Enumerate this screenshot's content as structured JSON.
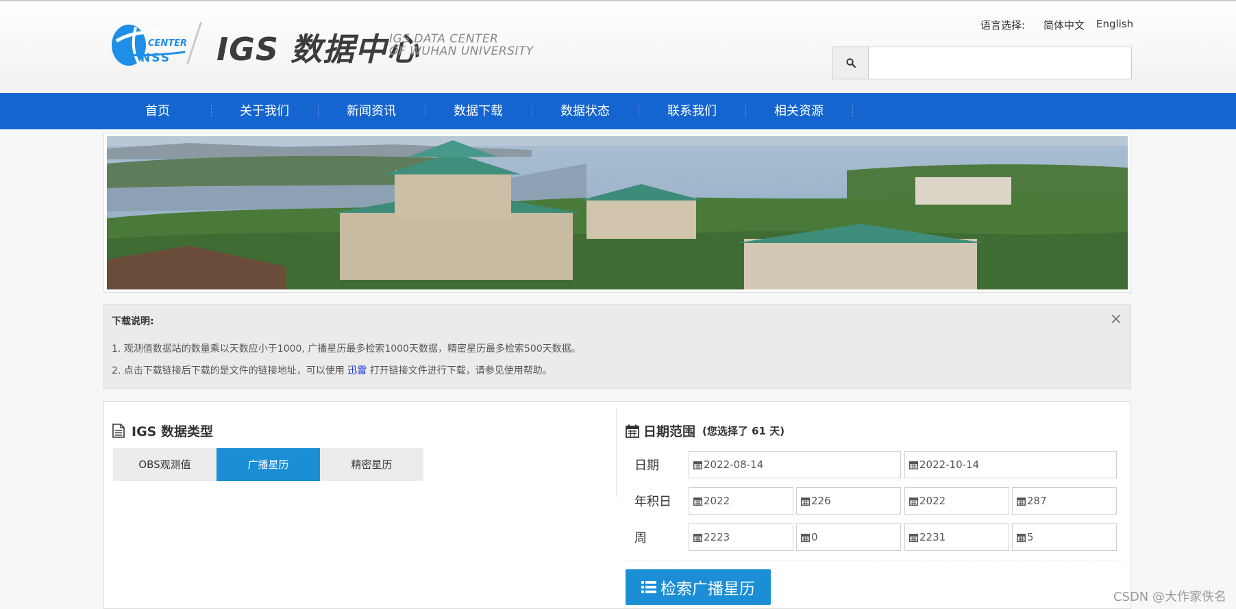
{
  "logo": {
    "mark_center": "CENTER",
    "mark_nss": "NSS",
    "title": "IGS 数据中心",
    "en_line1": "IGS DATA CENTER",
    "en_line2": "OF WUHAN UNIVERSITY"
  },
  "language": {
    "label": "语言选择:",
    "options": [
      "简体中文",
      "English"
    ]
  },
  "search": {
    "icon": "search-icon",
    "value": ""
  },
  "nav": {
    "items": [
      "首页",
      "关于我们",
      "新闻资讯",
      "数据下载",
      "数据状态",
      "联系我们",
      "相关资源"
    ]
  },
  "notice": {
    "title": "下载说明:",
    "line1": "1. 观测值数据站的数量乘以天数应小于1000, 广播星历最多检索1000天数据，精密星历最多检索500天数据。",
    "line2_before": "2. 点击下载链接后下载的是文件的链接地址，可以使用 ",
    "line2_link": "迅雷",
    "line2_after": " 打开链接文件进行下载，请参见使用帮助。",
    "close": "×"
  },
  "data_type": {
    "title": "IGS 数据类型",
    "tabs": [
      "OBS观测值",
      "广播星历",
      "精密星历"
    ],
    "active_tab": "广播星历"
  },
  "date_range": {
    "title": "日期范围",
    "note": "(您选择了 61 天)",
    "rows": [
      {
        "label": "日期",
        "fields": [
          "2022-08-14",
          "2022-10-14"
        ]
      },
      {
        "label": "年积日",
        "fields": [
          "2022",
          "226",
          "2022",
          "287"
        ]
      },
      {
        "label": "周",
        "fields": [
          "2223",
          "0",
          "2231",
          "5"
        ]
      }
    ],
    "submit": "检索广播星历"
  },
  "watermark": "CSDN @大作家佚名",
  "colors": {
    "nav": "#1565d0",
    "accent": "#1b8ed6",
    "link": "#1a33e6",
    "logo_blue": "#1e8ee6"
  }
}
